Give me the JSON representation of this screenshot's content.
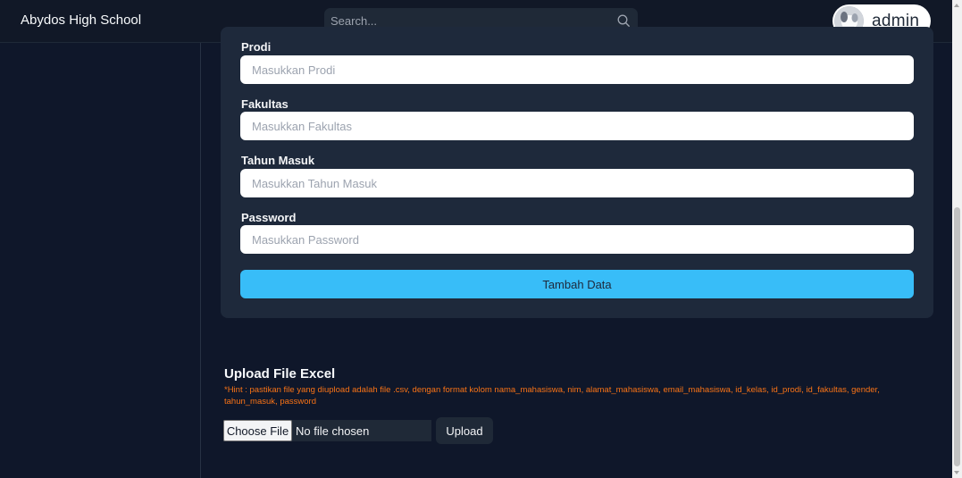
{
  "header": {
    "brand": "Abydos High School",
    "search_placeholder": "Search...",
    "username": "admin"
  },
  "form": {
    "fields": [
      {
        "label": "Prodi",
        "placeholder": "Masukkan Prodi"
      },
      {
        "label": "Fakultas",
        "placeholder": "Masukkan Fakultas"
      },
      {
        "label": "Tahun Masuk",
        "placeholder": "Masukkan Tahun Masuk"
      },
      {
        "label": "Password",
        "placeholder": "Masukkan Password"
      }
    ],
    "submit_label": "Tambah Data"
  },
  "upload": {
    "title": "Upload File Excel",
    "hint": "*Hint : pastikan file yang diupload adalah file .csv, dengan format kolom nama_mahasiswa, nim, alamat_mahasiswa, email_mahasiswa, id_kelas, id_prodi, id_fakultas, gender, tahun_masuk, password",
    "choose_label": "Choose File",
    "no_file_text": "No file chosen",
    "upload_label": "Upload"
  },
  "colors": {
    "background": "#0f172a",
    "card": "#1e293b",
    "accent": "#38bdf8",
    "hint": "#f97316"
  }
}
